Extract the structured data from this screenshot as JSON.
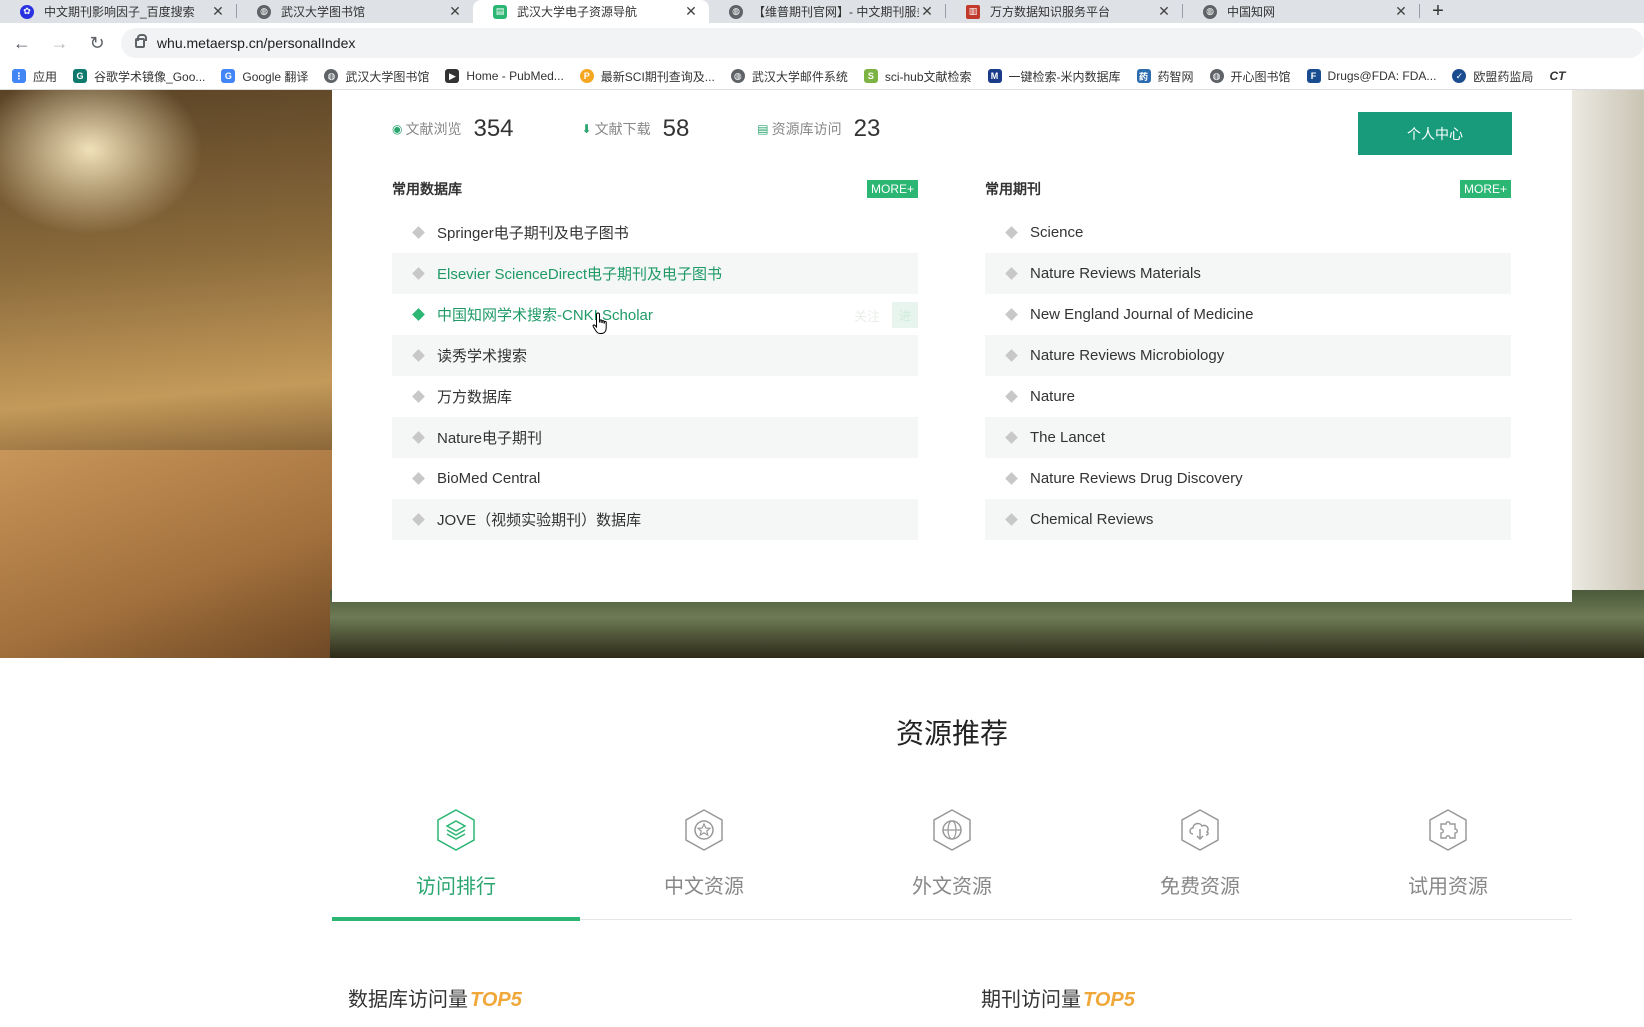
{
  "browser": {
    "tabs": [
      {
        "title": "中文期刊影响因子_百度搜索",
        "icon": "baidu-paw-icon",
        "color": "#2932e1",
        "active": false
      },
      {
        "title": "武汉大学图书馆",
        "icon": "globe-icon",
        "color": "#5f6368",
        "active": false
      },
      {
        "title": "武汉大学电子资源导航",
        "icon": "page-icon",
        "color": "#2bb673",
        "active": true
      },
      {
        "title": "【维普期刊官网】- 中文期刊服务",
        "icon": "globe-icon",
        "color": "#5f6368",
        "active": false
      },
      {
        "title": "万方数据知识服务平台",
        "icon": "wanfang-icon",
        "color": "#c0392b",
        "active": false
      },
      {
        "title": "中国知网",
        "icon": "globe-icon",
        "color": "#5f6368",
        "active": false
      }
    ],
    "url": "whu.metaersp.cn/personalIndex",
    "bookmarks": [
      {
        "label": "应用",
        "icon": "apps-grid-icon",
        "color": "#4285f4"
      },
      {
        "label": "谷歌学术镜像_Goo...",
        "icon": "scholar-icon",
        "color": "#0f7a6b"
      },
      {
        "label": "Google 翻译",
        "icon": "translate-icon",
        "color": "#4285f4"
      },
      {
        "label": "武汉大学图书馆",
        "icon": "globe-icon",
        "color": "#5f6368"
      },
      {
        "label": "Home - PubMed...",
        "icon": "pubmed-icon",
        "color": "#333"
      },
      {
        "label": "最新SCI期刊查询及...",
        "icon": "p-icon",
        "color": "#f5a623"
      },
      {
        "label": "武汉大学邮件系统",
        "icon": "globe-icon",
        "color": "#5f6368"
      },
      {
        "label": "sci-hub文献检索",
        "icon": "s-icon",
        "color": "#7cb342"
      },
      {
        "label": "一键检索-米内数据库",
        "icon": "m-icon",
        "color": "#1a3a8a"
      },
      {
        "label": "药智网",
        "icon": "drug-icon",
        "color": "#2b6cb0"
      },
      {
        "label": "开心图书馆",
        "icon": "globe-icon",
        "color": "#5f6368"
      },
      {
        "label": "Drugs@FDA: FDA...",
        "icon": "fda-icon",
        "color": "#1a4d8f"
      },
      {
        "label": "欧盟药监局",
        "icon": "ema-icon",
        "color": "#1a4d8f"
      },
      {
        "label": "CT",
        "icon": "ct-icon",
        "color": "#333"
      }
    ]
  },
  "stats": [
    {
      "label": "文献浏览",
      "value": "354",
      "icon": "eye-icon"
    },
    {
      "label": "文献下载",
      "value": "58",
      "icon": "download-icon"
    },
    {
      "label": "资源库访问",
      "value": "23",
      "icon": "database-icon"
    }
  ],
  "personal_center": "个人中心",
  "databases": {
    "title": "常用数据库",
    "more": "MORE+",
    "items": [
      "Springer电子期刊及电子图书",
      "Elsevier ScienceDirect电子期刊及电子图书",
      "中国知网学术搜索-CNKI Scholar",
      "读秀学术搜索",
      "万方数据库",
      "Nature电子期刊",
      "BioMed Central",
      "JOVE（视频实验期刊）数据库"
    ],
    "hover_follow": "关注",
    "hover_go": "进"
  },
  "journals": {
    "title": "常用期刊",
    "more": "MORE+",
    "items": [
      "Science",
      "Nature Reviews Materials",
      "New England Journal of Medicine",
      "Nature Reviews Microbiology",
      "Nature",
      "The Lancet",
      "Nature Reviews Drug Discovery",
      "Chemical Reviews"
    ]
  },
  "recommend": {
    "title": "资源推荐",
    "tabs": [
      {
        "label": "访问排行",
        "icon": "layers-hex-icon",
        "active": true
      },
      {
        "label": "中文资源",
        "icon": "star-hex-icon",
        "active": false
      },
      {
        "label": "外文资源",
        "icon": "globe-hex-icon",
        "active": false
      },
      {
        "label": "免费资源",
        "icon": "cloud-download-hex-icon",
        "active": false
      },
      {
        "label": "试用资源",
        "icon": "puzzle-hex-icon",
        "active": false
      }
    ]
  },
  "top5": {
    "db_label": "数据库访问量",
    "journal_label": "期刊访问量",
    "suffix": "TOP5"
  },
  "colors": {
    "accent": "#2bb673",
    "button": "#179b7b",
    "top5": "#f0a83a"
  }
}
